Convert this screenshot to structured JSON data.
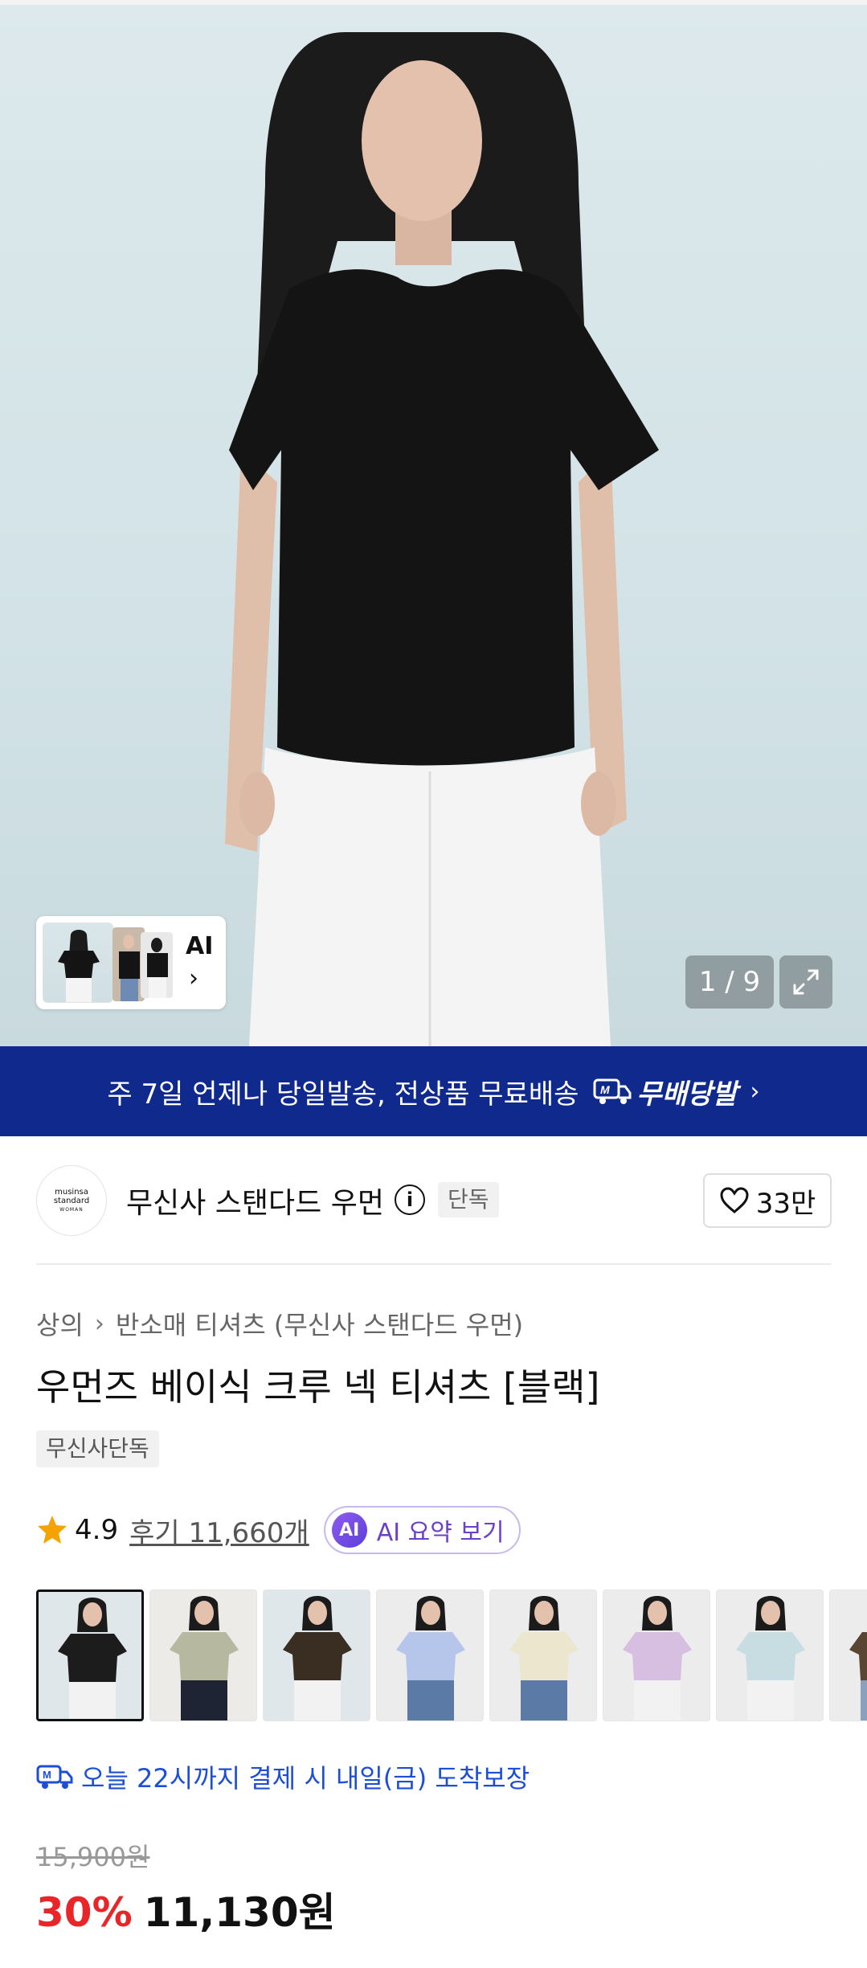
{
  "gallery": {
    "counter": "1 / 9",
    "ai_label": "AI"
  },
  "banner": {
    "text": "주 7일 언제나 당일발송, 전상품 무료배송",
    "logo_text": "무배당발"
  },
  "brand": {
    "name": "무신사 스탠다드 우먼",
    "tag": "단독",
    "like_count": "33만"
  },
  "breadcrumb": {
    "level1": "상의",
    "level2": "반소매 티셔츠 (무신사 스탠다드 우먼)"
  },
  "product": {
    "title": "우먼즈 베이식 크루 넥 티셔츠 [블랙]",
    "exclusive_badge": "무신사단독",
    "rating": "4.9",
    "review_link": "후기 11,660개",
    "ai_summary_label": "AI 요약 보기",
    "ai_badge": "AI"
  },
  "swatches": [
    {
      "color": "#1c1c1c",
      "bottom": "#f2f2f2",
      "bg": "#dfe7ea"
    },
    {
      "color": "#b7b8a0",
      "bottom": "#1e2433",
      "bg": "#ecebe7"
    },
    {
      "color": "#3a2e22",
      "bottom": "#f2f2f2",
      "bg": "#dfe7ea"
    },
    {
      "color": "#b6c6ea",
      "bottom": "#5c7aa6",
      "bg": "#ececec"
    },
    {
      "color": "#ece6cf",
      "bottom": "#5c7aa6",
      "bg": "#ececec"
    },
    {
      "color": "#d7bfe1",
      "bottom": "#f2f2f2",
      "bg": "#ececec"
    },
    {
      "color": "#c8dde2",
      "bottom": "#f2f2f2",
      "bg": "#ececec"
    },
    {
      "color": "#5a4533",
      "bottom": "#8aa0bd",
      "bg": "#ececec"
    }
  ],
  "delivery": {
    "text": "오늘 22시까지 결제 시 내일(금) 도착보장"
  },
  "price": {
    "original": "15,900원",
    "discount": "30%",
    "final": "11,130원"
  },
  "colors": {
    "banner_bg": "#0f2a8c",
    "discount_red": "#e8262a",
    "delivery_blue": "#1d4fd6",
    "ai_purple": "#6a3fc9",
    "star": "#f5a300"
  }
}
